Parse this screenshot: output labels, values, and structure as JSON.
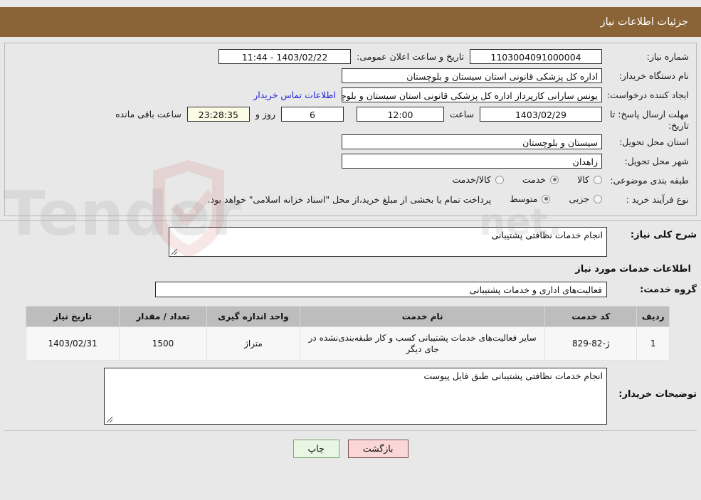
{
  "header": {
    "title": "جزئیات اطلاعات نیاز"
  },
  "form": {
    "need_number": {
      "label": "شماره نیاز:",
      "value": "1103004091000004"
    },
    "public_announce": {
      "label": "تاریخ و ساعت اعلان عمومی:",
      "value": "1403/02/22 - 11:44"
    },
    "buyer_org": {
      "label": "نام دستگاه خریدار:",
      "value": "اداره کل پزشکی قانونی استان سیستان و بلوچستان"
    },
    "requester": {
      "label": "ایجاد کننده درخواست:",
      "value": "یونس سارانی کارپرداز اداره کل پزشکی قانونی استان سیستان و بلوچستان",
      "contact_link": "اطلاعات تماس خریدار"
    },
    "deadline": {
      "label": "مهلت ارسال پاسخ: تا تاریخ:",
      "date": "1403/02/29",
      "time_label": "ساعت",
      "time": "12:00",
      "days": "6",
      "days_label": "روز و",
      "clock": "23:28:35",
      "remaining_label": "ساعت باقی مانده"
    },
    "province": {
      "label": "استان محل تحویل:",
      "value": "سیستان و بلوچستان"
    },
    "city": {
      "label": "شهر محل تحویل:",
      "value": "زاهدان"
    },
    "category": {
      "label": "طبقه بندی موضوعی:",
      "options": [
        {
          "label": "کالا",
          "selected": false
        },
        {
          "label": "خدمت",
          "selected": true
        },
        {
          "label": "کالا/خدمت",
          "selected": false
        }
      ]
    },
    "purchase_type": {
      "label": "نوع فرآیند خرید :",
      "options": [
        {
          "label": "جزیی",
          "selected": false
        },
        {
          "label": "متوسط",
          "selected": true
        }
      ],
      "note": "پرداخت تمام یا بخشی از مبلغ خرید،از محل \"اسناد خزانه اسلامی\" خواهد بود."
    }
  },
  "need_summary": {
    "label": "شرح کلی نیاز:",
    "value": "انجام خدمات نظافتی پشتیبانی"
  },
  "services_section": {
    "title": "اطلاعات خدمات مورد نیاز",
    "group_label": "گروه خدمت:",
    "group_value": "فعالیت‌های اداری و خدمات پشتیبانی"
  },
  "table": {
    "columns": [
      "ردیف",
      "کد خدمت",
      "نام خدمت",
      "واحد اندازه گیری",
      "تعداد / مقدار",
      "تاریخ نیاز"
    ],
    "rows": [
      {
        "index": "1",
        "code": "ژ-82-829",
        "name": "سایر فعالیت‌های خدمات پشتیبانی کسب و کار طبقه‌بندی‌نشده در جای دیگر",
        "unit": "متراژ",
        "qty": "1500",
        "date": "1403/02/31"
      }
    ]
  },
  "buyer_notes": {
    "label": "توضیحات خریدار:",
    "value": "انجام خدمات نظافتی پشتیبانی طبق فایل پیوست"
  },
  "actions": {
    "print": "چاپ",
    "back": "بازگشت"
  },
  "watermark": {
    "text": "AnaTender.net"
  },
  "colors": {
    "header_bg": "#8a6436",
    "link": "#2020dd",
    "table_header": "#bdbdbd",
    "print_btn": "#e9f6e4",
    "back_btn": "#fbd6d6",
    "clock_bg": "#fbfbe6"
  }
}
